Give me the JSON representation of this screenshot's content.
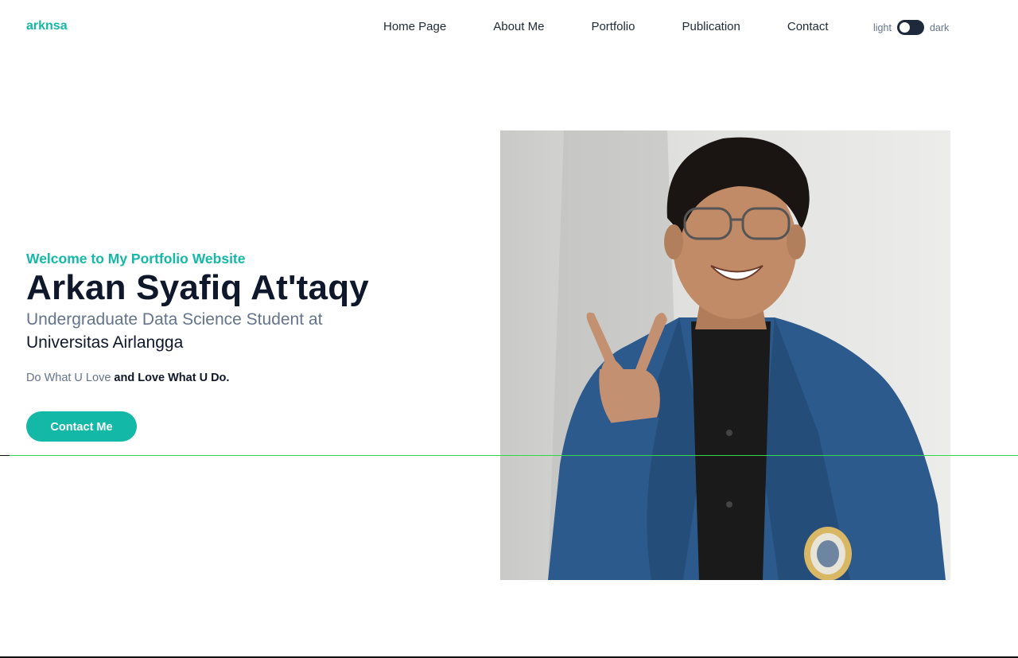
{
  "brand": {
    "name": "arknsa",
    "color": "#14b8a6"
  },
  "nav": {
    "items": [
      {
        "label": "Home Page"
      },
      {
        "label": "About Me"
      },
      {
        "label": "Portfolio"
      },
      {
        "label": "Publication"
      },
      {
        "label": "Contact"
      }
    ]
  },
  "theme_toggle": {
    "light_label": "light",
    "dark_label": "dark",
    "state": "light"
  },
  "hero": {
    "welcome": "Welcome to My Portfolio Website",
    "name": "Arkan Syafiq At'taqy",
    "subtitle": "Undergraduate Data Science Student at",
    "university": "Universitas Airlangga",
    "motto_plain": "Do What U Love ",
    "motto_bold": "and Love What U Do.",
    "cta_label": "Contact Me"
  },
  "colors": {
    "accent": "#14b8a6",
    "heading": "#0f172a",
    "muted": "#64748b",
    "guide_line": "#32d74b"
  },
  "photo": {
    "icon": "portrait-photo"
  }
}
